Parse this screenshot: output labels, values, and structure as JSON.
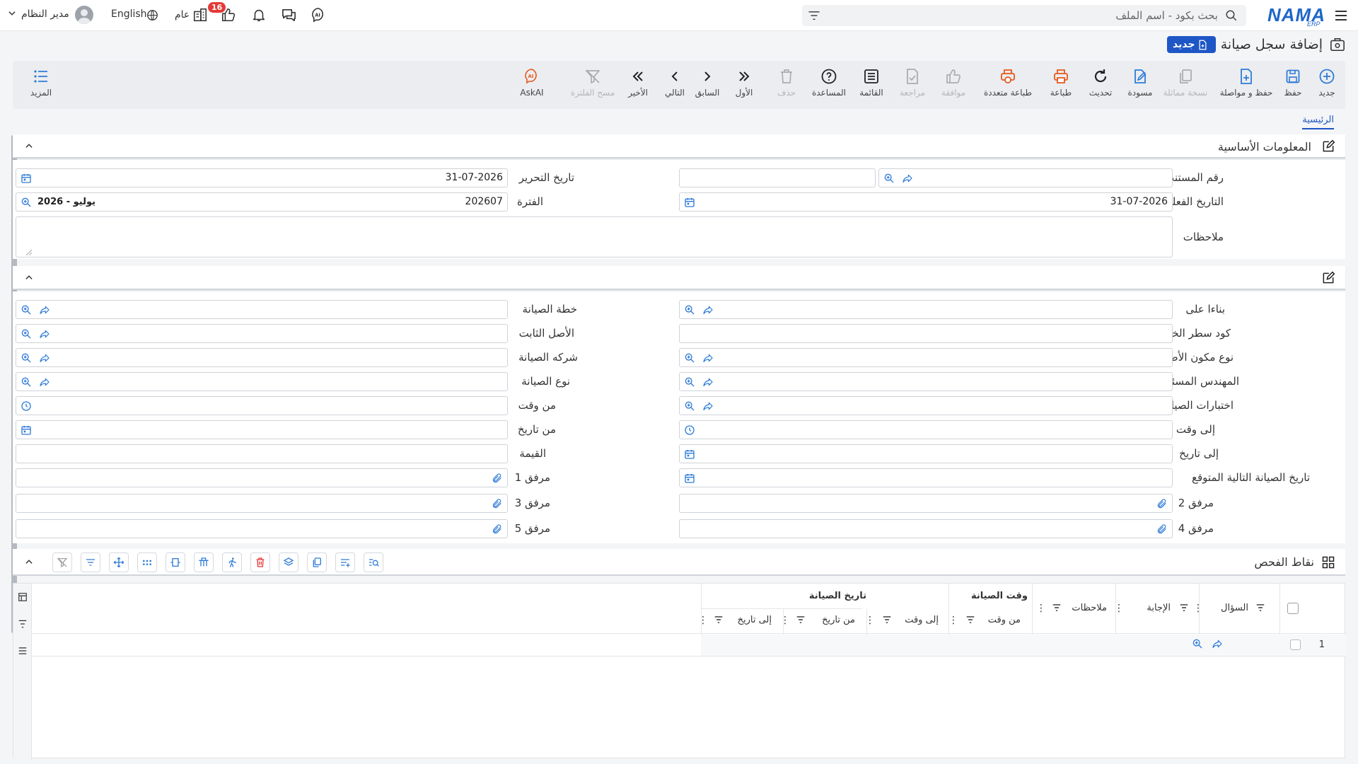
{
  "topbar": {
    "brand": "NAMA",
    "brand_sub": "ERP",
    "search_placeholder": "بحث بكود - اسم الملف",
    "user_name": "مدير النظام",
    "language": "English",
    "scope": "عام",
    "notification_count": "16"
  },
  "page": {
    "title": "إضافة سجل صيانة",
    "status_badge": "جديد"
  },
  "toolbar": {
    "new": "جديد",
    "save": "حفظ",
    "save_continue": "حفظ و مواصلة",
    "duplicate": "نسخة مماثلة",
    "draft": "مسودة",
    "refresh": "تحديث",
    "print": "طباعة",
    "multi_print": "طباعة متعددة",
    "approve": "موافقة",
    "review": "مراجعة",
    "list": "القائمة",
    "help": "المساعدة",
    "delete": "حذف",
    "first": "الأول",
    "previous": "السابق",
    "next": "التالي",
    "last": "الأخير",
    "clear_filter": "مسح الفلترة",
    "askai": "AskAI",
    "more": "المزيد"
  },
  "tabs": {
    "main": "الرئيسية"
  },
  "basic_info": {
    "title": "المعلومات الأساسية",
    "doc_number_label": "رقم المستند",
    "doc_number_value": "",
    "edit_date_label": "تاريخ التحرير",
    "edit_date_value": "31-07-2026",
    "actual_date_label": "التاريخ الفعلي",
    "actual_date_value": "31-07-2026",
    "period_label": "الفترة",
    "period_value": "202607",
    "period_name": "2026 - يوليو",
    "notes_label": "ملاحظات",
    "notes_value": ""
  },
  "details": {
    "based_on": "بناءا على",
    "maintenance_plan": "خطة الصيانة",
    "plan_line_code": "كود سطر الخطه",
    "fixed_asset": "الأصل الثابت",
    "asset_component_type": "نوع مكون الأصل",
    "maintenance_company": "شركه الصيانة",
    "responsible_engineer": "المهندس المسئول",
    "maintenance_type": "نوع الصيانة",
    "maintenance_tests": "اختبارات الصيانة",
    "from_time": "من وقت",
    "to_time": "إلى وقت",
    "from_date": "من تاريخ",
    "to_date": "إلى تاريخ",
    "value": "القيمة",
    "next_expected_date": "تاريخ الصيانة التالية المتوقع",
    "attachment_1": "مرفق 1",
    "attachment_2": "مرفق 2",
    "attachment_3": "مرفق 3",
    "attachment_4": "مرفق 4",
    "attachment_5": "مرفق 5"
  },
  "inspection": {
    "title": "نقاط الفحص",
    "columns": {
      "question": "السؤال",
      "answer": "الإجابة",
      "notes": "ملاحظات",
      "maintenance_time": "وقت الصيانة",
      "from_time": "من وقت",
      "to_time": "إلى وقت",
      "maintenance_date": "تاريخ الصيانة",
      "from_date": "من تاريخ",
      "to_date": "إلى تاريخ"
    },
    "rows": [
      {
        "index": "1"
      }
    ]
  }
}
